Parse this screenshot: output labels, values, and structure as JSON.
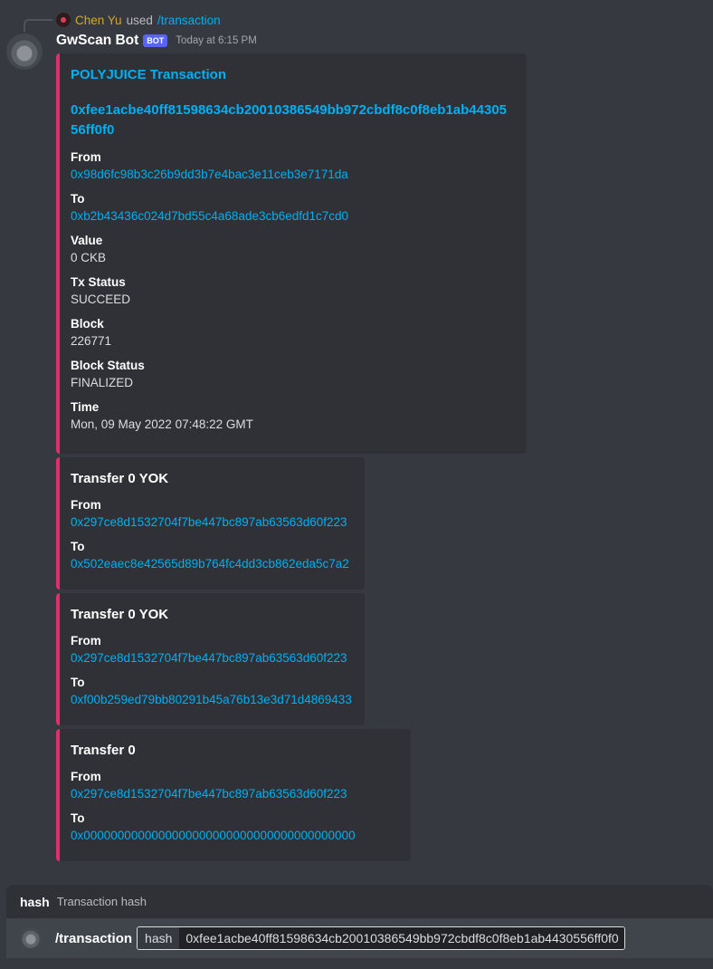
{
  "reply": {
    "username": "Chen Yu",
    "used_text": "used",
    "command": "/transaction"
  },
  "message": {
    "bot_name": "GwScan Bot",
    "bot_tag": "BOT",
    "timestamp": "Today at 6:15 PM"
  },
  "embeds": {
    "main": {
      "title": "POLYJUICE Transaction",
      "hash": "0xfee1acbe40ff81598634cb20010386549bb972cbdf8c0f8eb1ab4430556ff0f0",
      "fields": [
        {
          "name": "From",
          "value": "0x98d6fc98b3c26b9dd3b7e4bac3e11ceb3e7171da"
        },
        {
          "name": "To",
          "value": "0xb2b43436c024d7bd55c4a68ade3cb6edfd1c7cd0"
        },
        {
          "name": "Value",
          "value": "0 CKB"
        },
        {
          "name": "Tx Status",
          "value": "SUCCEED"
        },
        {
          "name": "Block",
          "value": "226771"
        },
        {
          "name": "Block Status",
          "value": "FINALIZED"
        },
        {
          "name": "Time",
          "value": "Mon, 09 May 2022 07:48:22 GMT"
        }
      ]
    },
    "transfers": [
      {
        "title": "Transfer 0 YOK",
        "from_label": "From",
        "from": "0x297ce8d1532704f7be447bc897ab63563d60f223",
        "to_label": "To",
        "to": "0x502eaec8e42565d89b764fc4dd3cb862eda5c7a2"
      },
      {
        "title": "Transfer 0 YOK",
        "from_label": "From",
        "from": "0x297ce8d1532704f7be447bc897ab63563d60f223",
        "to_label": "To",
        "to": "0xf00b259ed79bb80291b45a76b13e3d71d4869433"
      },
      {
        "title": "Transfer 0",
        "from_label": "From",
        "from": "0x297ce8d1532704f7be447bc897ab63563d60f223",
        "to_label": "To",
        "to": "0x0000000000000000000000000000000000000000"
      }
    ]
  },
  "command_bar": {
    "option_name": "hash",
    "option_description": "Transaction hash",
    "command": "/transaction",
    "input_label": "hash",
    "input_value": "0xfee1acbe40ff81598634cb20010386549bb972cbdf8c0f8eb1ab4430556ff0f0"
  },
  "colors": {
    "background": "#36393f",
    "embed_background": "#2f3136",
    "embed_accent": "#e0306b",
    "link": "#00aff4",
    "bot_tag": "#5865f2",
    "reply_username": "#d4a62f"
  }
}
